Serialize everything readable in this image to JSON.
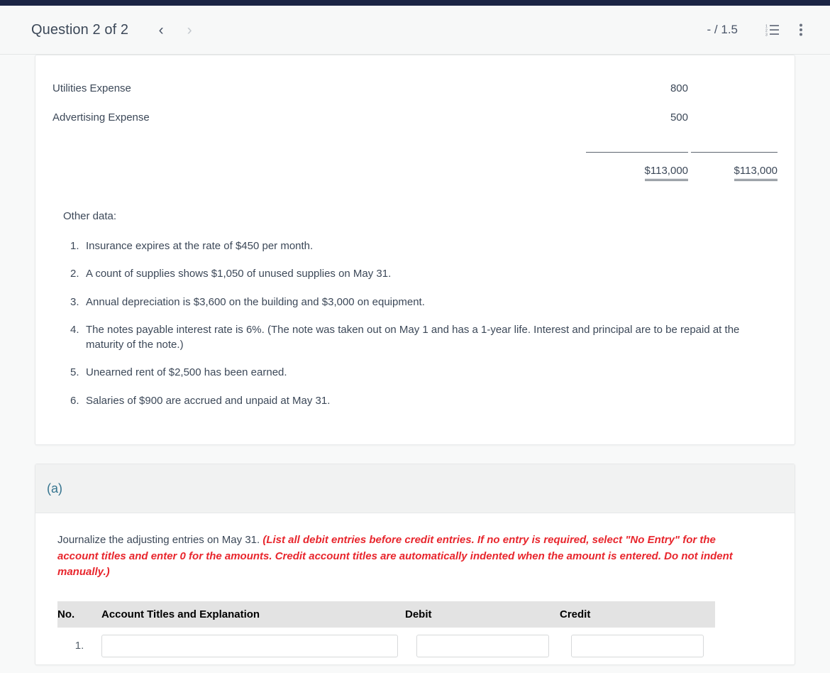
{
  "header": {
    "title": "Question 2 of 2",
    "prev_label": "‹",
    "next_label": "›",
    "score": "- / 1.5",
    "list_icon": "numbered-list-icon",
    "menu_icon": "more-vertical-icon"
  },
  "trial_balance": {
    "cut_row_text": "",
    "rows": [
      {
        "name": "Utilities Expense",
        "debit": "800",
        "credit": ""
      },
      {
        "name": "Advertising Expense",
        "debit": "500",
        "credit": ""
      }
    ],
    "totals": {
      "debit": "$113,000",
      "credit": "$113,000"
    }
  },
  "other_data": {
    "label": "Other data:",
    "items": [
      {
        "num": "1.",
        "text": "Insurance expires at the rate of $450 per month."
      },
      {
        "num": "2.",
        "text": "A count of supplies shows $1,050 of unused supplies on May 31."
      },
      {
        "num": "3.",
        "text": "Annual depreciation is $3,600 on the building and $3,000 on equipment."
      },
      {
        "num": "4.",
        "text": "The notes payable interest rate is 6%. (The note was taken out on May 1 and has a 1-year life. Interest and principal are to be repaid at the maturity of the note.)"
      },
      {
        "num": "5.",
        "text": "Unearned rent of $2,500 has been earned."
      },
      {
        "num": "6.",
        "text": "Salaries of $900 are accrued and unpaid at May 31."
      }
    ]
  },
  "part_a": {
    "letter": "(a)",
    "prompt_lead": "Journalize the adjusting entries on May 31. ",
    "prompt_required": "(List all debit entries before credit entries. If no entry is required, select \"No Entry\" for the account titles and enter 0 for the amounts. Credit account titles are automatically indented when the amount is entered. Do not indent manually.)",
    "journal": {
      "columns": [
        "No.",
        "Account Titles and Explanation",
        "Debit",
        "Credit"
      ],
      "rows": [
        {
          "no": "1.",
          "account": "",
          "debit": "",
          "credit": ""
        }
      ]
    }
  },
  "colors": {
    "topbar": "#1b2444",
    "accent_blue": "#35748f",
    "required_red": "#e8262d",
    "table_header_gray": "#e3e3e3"
  }
}
